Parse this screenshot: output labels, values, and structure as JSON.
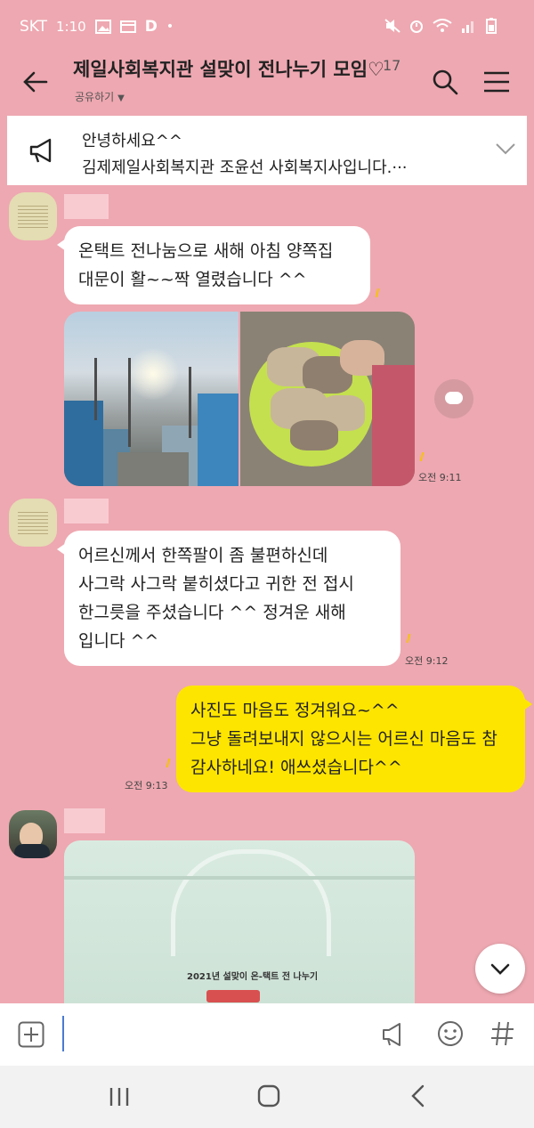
{
  "status": {
    "carrier": "SKT",
    "time": "1:10",
    "dot": "•",
    "d_badge": "D"
  },
  "header": {
    "title": "제일사회복지관 설맞이 전나누기 모임♡",
    "member_count": "17",
    "share_label": "공유하기",
    "share_caret": "▼"
  },
  "notice": {
    "line1": "안녕하세요^^",
    "line2": "김제제일사회복지관 조윤선 사회복지사입니다.···"
  },
  "messages": [
    {
      "lines": [
        "온택트 전나눔으로 새해 아침 양쪽집",
        "대문이 활~~짝 열렸습니다 ^^"
      ]
    },
    {
      "time": "오전 9:11"
    },
    {
      "lines": [
        "어르신께서 한쪽팔이 좀 불편하신데",
        "사그락 사그락 붙히셨다고 귀한 전 접시",
        "한그릇을 주셨습니다 ^^ 정겨운 새해",
        "입니다 ^^"
      ],
      "time": "오전 9:12"
    },
    {
      "lines": [
        "사진도 마음도 정겨워요~^^",
        "그냥 돌려보내지 않으시는 어르신 마음도 참",
        "감사하네요! 애쓰셨습니다^^"
      ],
      "time": "오전 9:13"
    }
  ],
  "bag_text": "2021년 설맞이 온-택트 전 나누기",
  "input": {
    "value": "",
    "placeholder": ""
  },
  "colors": {
    "background": "#eea8b1",
    "my_bubble": "#fee500",
    "other_bubble": "#ffffff"
  }
}
